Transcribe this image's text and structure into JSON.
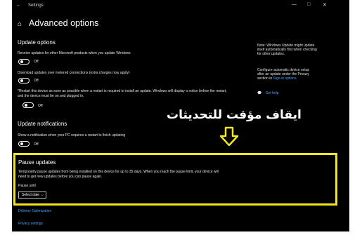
{
  "window": {
    "title": "Settings",
    "back": "←",
    "controls": {
      "minimize": "—",
      "maximize": "□",
      "close": "✕"
    }
  },
  "header": {
    "title": "Advanced options"
  },
  "update_options": {
    "title": "Update options",
    "receive_text": "Receive updates for other Microsoft products when you update Windows",
    "receive_state": "Off",
    "metered_text": "Download updates over metered connections (extra charges may apply)",
    "metered_state": "Off",
    "restart_text_1": "*Restart this device as soon as possible when a restart is required to install an update. Windows will display a notice before the restart,",
    "restart_text_2": "and the device must be on and plugged in.",
    "restart_state": "Off"
  },
  "notifications": {
    "title": "Update notifications",
    "text": "Show a notification when your PC requires a restart to finish updating",
    "state": "Off"
  },
  "pause": {
    "title": "Pause updates",
    "text_1": "Temporarily pause updates from being installed on this device for up to 35 days. When you reach the pause limit, your device will",
    "text_2": "need to get new updates before you can pause again.",
    "until_label": "Pause until",
    "select_value": "Select date"
  },
  "sidebar": {
    "note_1": "Note: Windows Update might update",
    "note_2": "itself automatically first when checking",
    "note_3": "for other updates.",
    "privacy_1": "Configure automatic device setup",
    "privacy_2": "after an update under the Privacy",
    "privacy_3_prefix": "section in",
    "privacy_link": "Sign-in options",
    "help": "Get help"
  },
  "annotation": {
    "arabic_text": "ايقاف مؤقت للتحديثات"
  },
  "links": {
    "delivery": "Delivery Optimization",
    "privacy": "Privacy settings"
  },
  "colors": {
    "accent": "#4aa3ff",
    "highlight": "#f2e51d",
    "background": "#000000"
  }
}
